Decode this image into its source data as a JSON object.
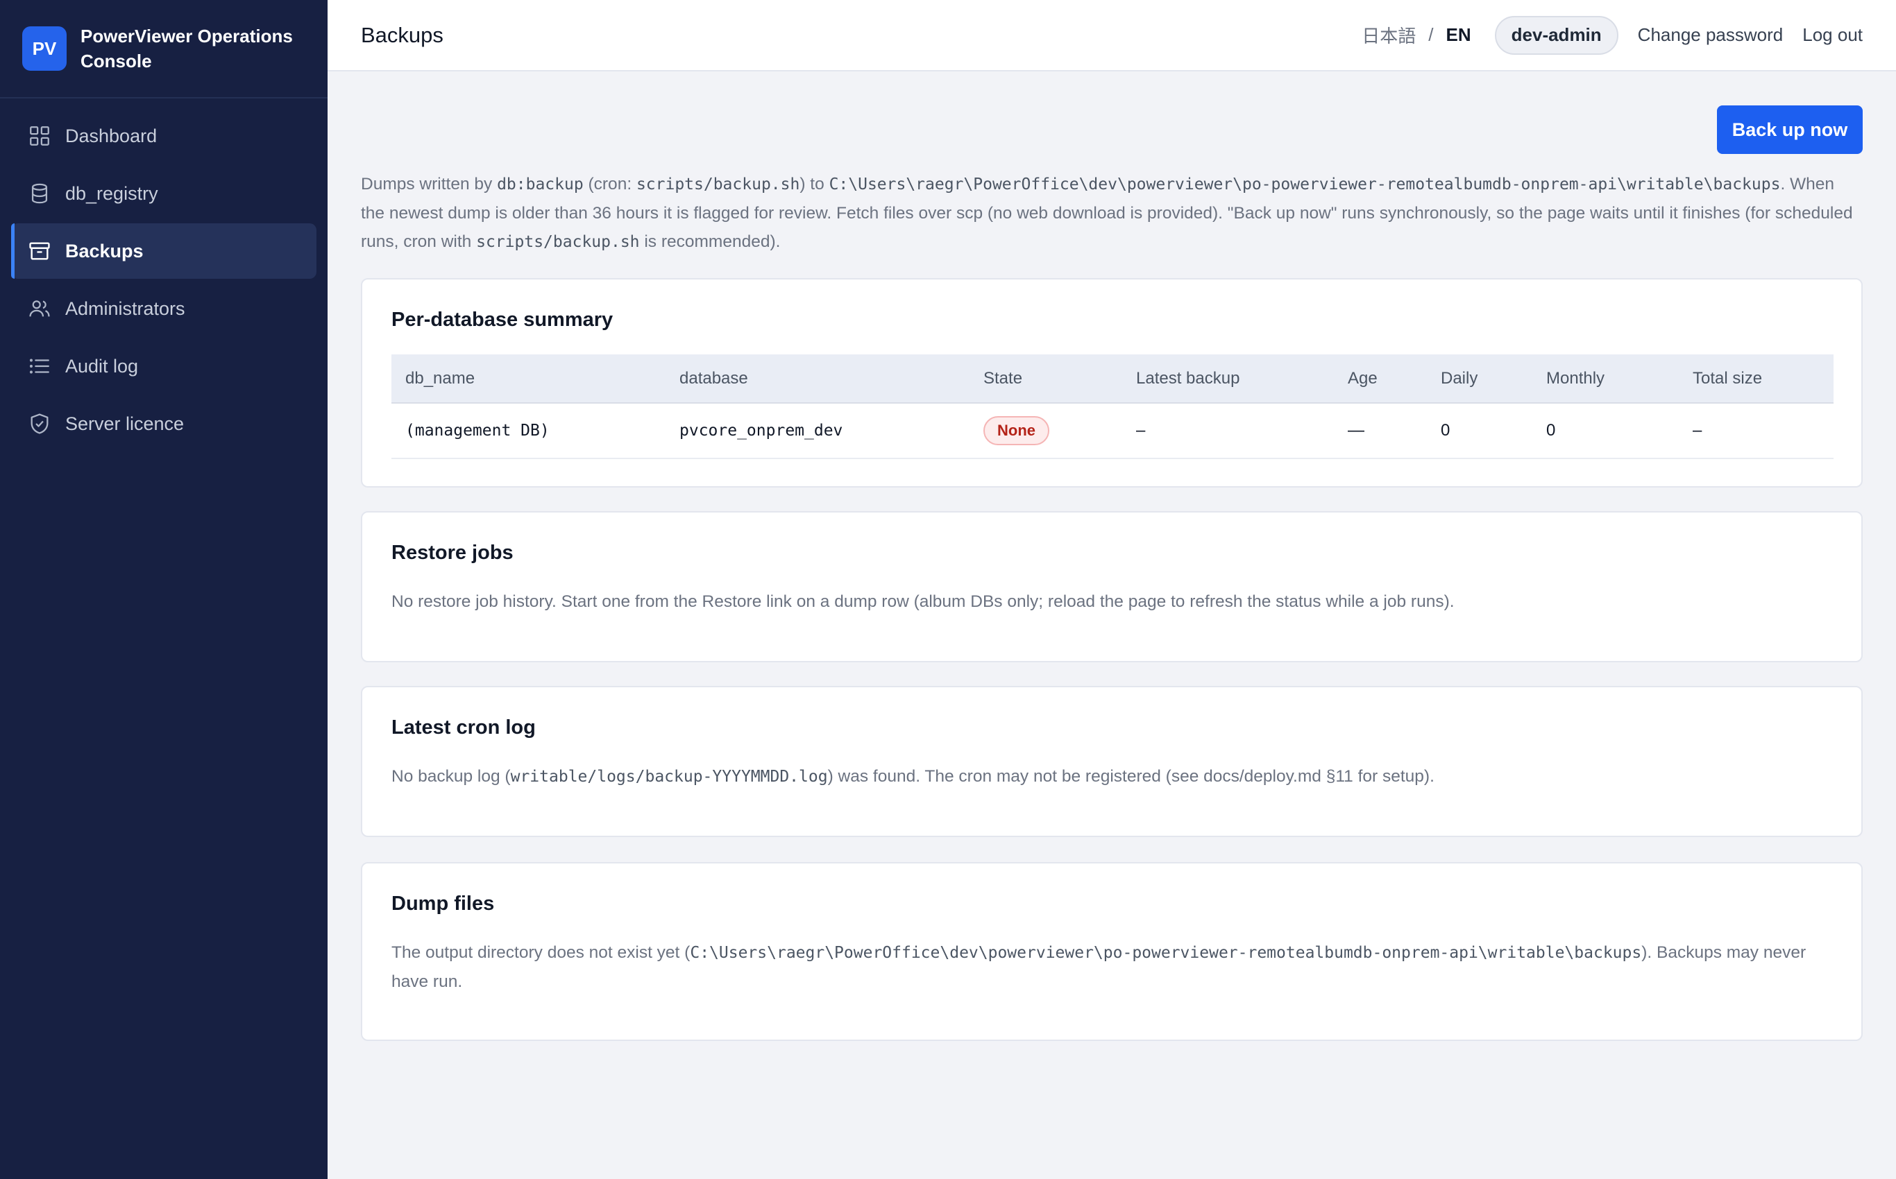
{
  "sidebar": {
    "logo_text": "PV",
    "app_title": "PowerViewer Operations Console",
    "items": [
      {
        "label": "Dashboard",
        "icon": "dashboard-grid-icon"
      },
      {
        "label": "db_registry",
        "icon": "database-icon"
      },
      {
        "label": "Backups",
        "icon": "archive-box-icon",
        "active": true
      },
      {
        "label": "Administrators",
        "icon": "users-icon"
      },
      {
        "label": "Audit log",
        "icon": "list-icon"
      },
      {
        "label": "Server licence",
        "icon": "shield-check-icon"
      }
    ]
  },
  "header": {
    "title": "Backups",
    "lang_ja": "日本語",
    "lang_sep": "/",
    "lang_en": "EN",
    "user": "dev-admin",
    "change_password": "Change password",
    "logout": "Log out"
  },
  "main": {
    "backup_button": "Back up now",
    "intro": {
      "t1": "Dumps written by ",
      "cmd": "db:backup",
      "t2": " (cron: ",
      "script": "scripts/backup.sh",
      "t3": ") to ",
      "path": "C:\\Users\\raegr\\PowerOffice\\dev\\powerviewer\\po-powerviewer-remotealbumdb-onprem-api\\writable\\backups",
      "t4": ". When the newest dump is older than 36 hours it is flagged for review. Fetch files over scp (no web download is provided). \"Back up now\" runs synchronously, so the page waits until it finishes (for scheduled runs, cron with ",
      "script2": "scripts/backup.sh",
      "t5": " is recommended)."
    },
    "summary": {
      "title": "Per-database summary",
      "columns": [
        "db_name",
        "database",
        "State",
        "Latest backup",
        "Age",
        "Daily",
        "Monthly",
        "Total size"
      ],
      "rows": [
        {
          "db_name": "(management DB)",
          "database": "pvcore_onprem_dev",
          "state": "None",
          "latest_backup": "–",
          "age": "—",
          "daily": "0",
          "monthly": "0",
          "total_size": "–"
        }
      ]
    },
    "restore": {
      "title": "Restore jobs",
      "text": "No restore job history. Start one from the Restore link on a dump row (album DBs only; reload the page to refresh the status while a job runs)."
    },
    "cron": {
      "title": "Latest cron log",
      "t1": "No backup log (",
      "file": "writable/logs/backup-YYYYMMDD.log",
      "t2": ") was found. The cron may not be registered (see docs/deploy.md §11 for setup)."
    },
    "dumps": {
      "title": "Dump files",
      "t1": "The output directory does not exist yet (",
      "path": "C:\\Users\\raegr\\PowerOffice\\dev\\powerviewer\\po-powerviewer-remotealbumdb-onprem-api\\writable\\backups",
      "t2": "). Backups may never have run."
    }
  },
  "colors": {
    "sidebar_bg": "#172042",
    "accent": "#1d5ff0",
    "badge_none_bg": "#fdecec",
    "badge_none_text": "#b42318"
  }
}
